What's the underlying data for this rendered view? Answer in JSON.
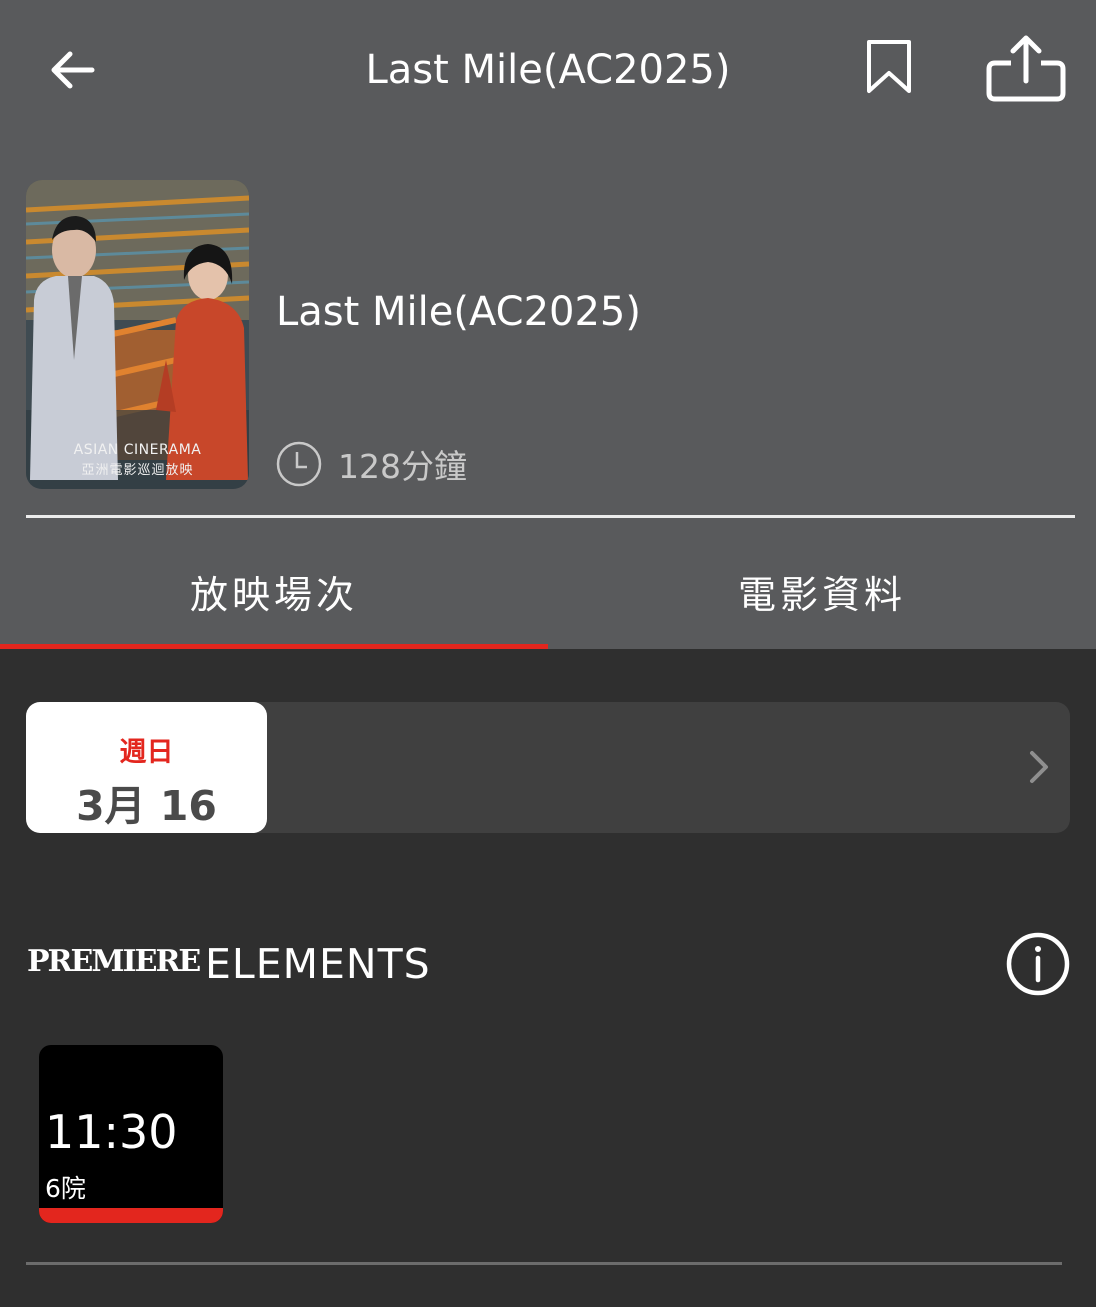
{
  "header": {
    "title": "Last Mile(AC2025)",
    "back_icon": "arrow-left-icon",
    "bookmark_icon": "bookmark-icon",
    "share_icon": "share-icon"
  },
  "movie": {
    "title": "Last Mile(AC2025)",
    "duration": "128分鐘",
    "poster_caption_en": "ASIAN CINERAMA",
    "poster_caption_zh": "亞洲電影巡迴放映"
  },
  "tabs": [
    {
      "label": "放映場次",
      "active": true
    },
    {
      "label": "電影資料",
      "active": false
    }
  ],
  "date_selector": {
    "weekday": "週日",
    "date": "3月 16",
    "next_icon": "chevron-right-icon"
  },
  "cinema": {
    "logo_text": "PREMIERE",
    "name": "ELEMENTS",
    "info_icon": "info-icon"
  },
  "showtimes": [
    {
      "time": "11:30",
      "house": "6院"
    }
  ],
  "colors": {
    "accent": "#e3261e",
    "header_bg": "#595a5c",
    "page_bg": "#2f2f2f",
    "date_strip_bg": "#404040"
  }
}
